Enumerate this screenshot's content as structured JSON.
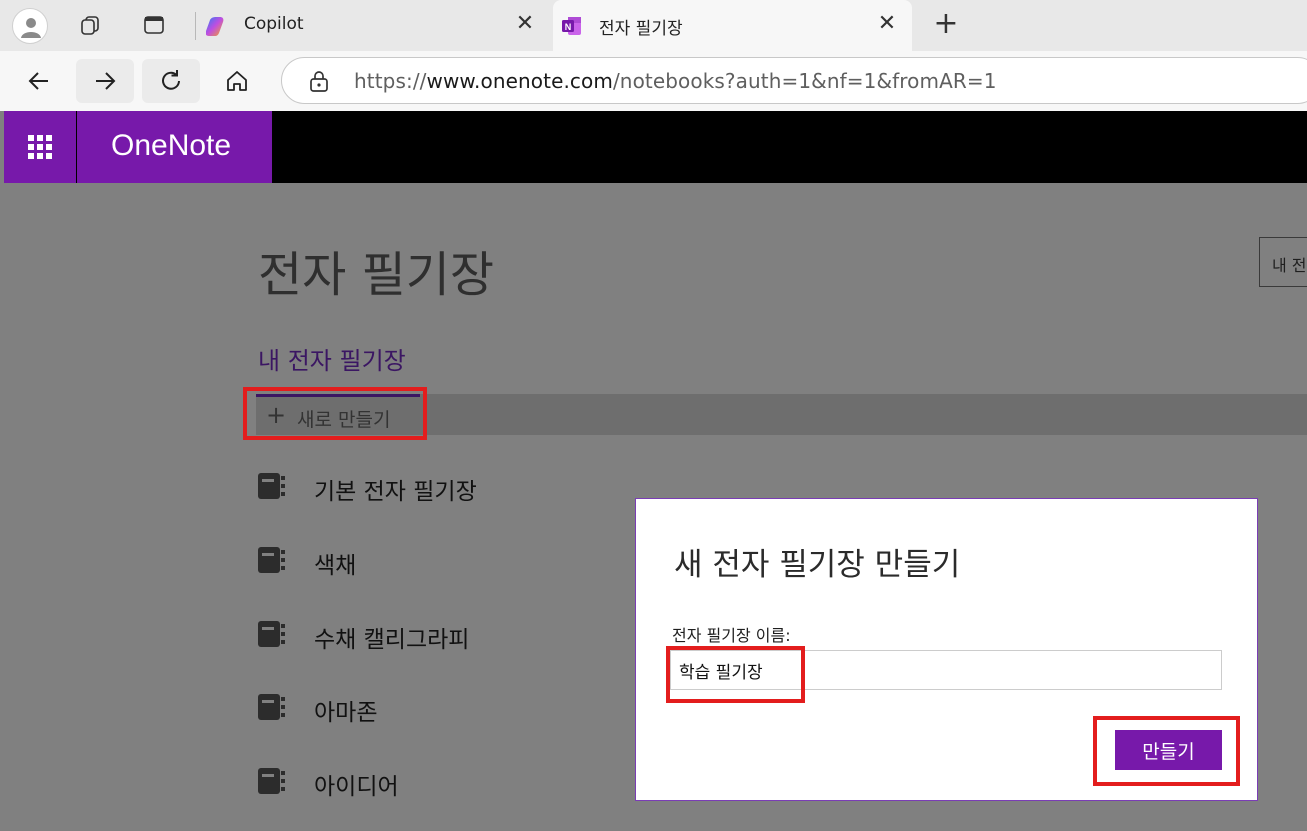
{
  "browser": {
    "tabs": [
      {
        "title": "Copilot",
        "icon": "copilot-icon"
      },
      {
        "title": "전자 필기장",
        "icon": "onenote-icon",
        "active": true
      }
    ],
    "tab_close_glyph": "✕",
    "new_tab_glyph": "+",
    "url": {
      "prefix": "https://",
      "host": "www.onenote.com",
      "path": "/notebooks?auth=1&nf=1&fromAR=1"
    }
  },
  "app": {
    "name": "OneNote",
    "brand_color": "#7719aa"
  },
  "page": {
    "title": "전자 필기장",
    "open_button_label": "내 전",
    "section_title": "내 전자 필기장",
    "new_button": {
      "icon": "plus-icon",
      "label": "새로 만들기"
    },
    "notebooks": [
      {
        "name": "기본 전자 필기장"
      },
      {
        "name": "색채"
      },
      {
        "name": "수채 캘리그라피"
      },
      {
        "name": "아마존"
      },
      {
        "name": "아이디어"
      }
    ]
  },
  "dialog": {
    "title": "새 전자 필기장 만들기",
    "field_label": "전자 필기장 이름:",
    "name_value": "학습 필기장",
    "create_label": "만들기"
  },
  "colors": {
    "highlight": "#e31d1d",
    "overlay": "#808080",
    "section_title": "#3b1663"
  }
}
